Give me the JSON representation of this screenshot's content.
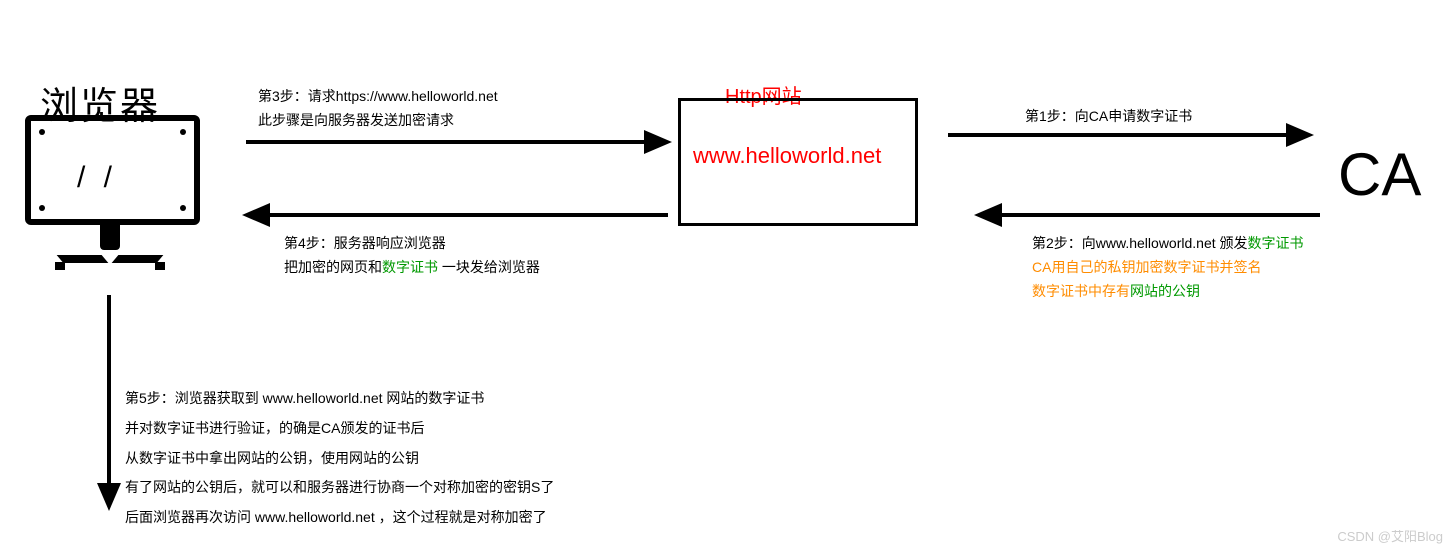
{
  "browser_label": "浏览器",
  "site": {
    "top_label": "Http网站",
    "url": "www.helloworld.net"
  },
  "ca_label": "CA",
  "step1": {
    "text": "第1步：向CA申请数字证书"
  },
  "step2": {
    "prefix": "第2步：向www.helloworld.net 颁发",
    "cert": "数字证书",
    "line2": "CA用自己的私钥加密数字证书并签名",
    "line3_a": "数字证书中存有",
    "line3_b": "网站的公钥"
  },
  "step3": {
    "line1": "第3步：请求https://www.helloworld.net",
    "line2": "此步骤是向服务器发送加密请求"
  },
  "step4": {
    "line1": "第4步：服务器响应浏览器",
    "line2_a": "把加密的网页和",
    "line2_b": "数字证书",
    "line2_c": " 一块发给浏览器"
  },
  "step5": {
    "line1": "第5步：浏览器获取到 www.helloworld.net 网站的数字证书",
    "line2": "并对数字证书进行验证，的确是CA颁发的证书后",
    "line3": "从数字证书中拿出网站的公钥，使用网站的公钥",
    "line4": "有了网站的公钥后，就可以和服务器进行协商一个对称加密的密钥S了",
    "line5": "后面浏览器再次访问 www.helloworld.net ，这个过程就是对称加密了"
  },
  "watermark": "CSDN @艾阳Blog"
}
